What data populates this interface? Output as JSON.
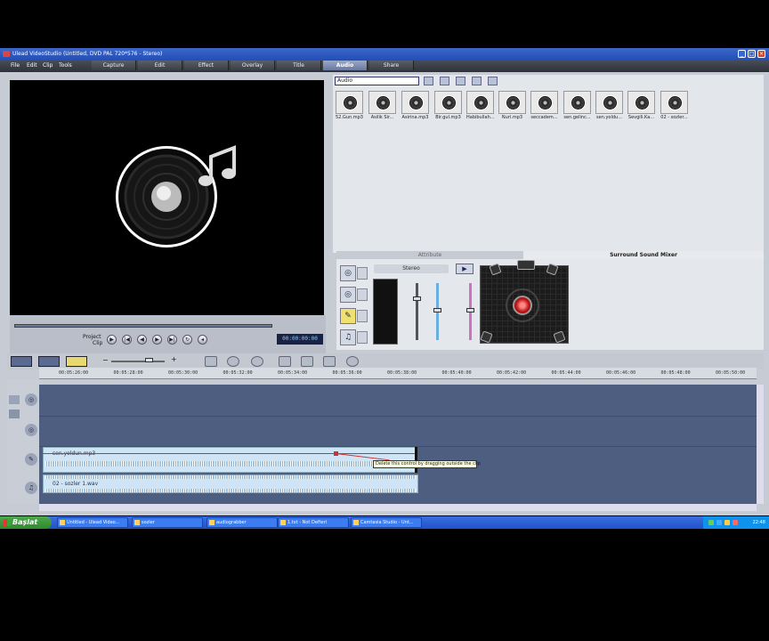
{
  "window": {
    "title": "Ulead VideoStudio (Untitled, DVD PAL 720*576 - Stereo)",
    "menus": [
      "File",
      "Edit",
      "Clip",
      "Tools"
    ],
    "steps": [
      "Capture",
      "Edit",
      "Effect",
      "Overlay",
      "Title",
      "Audio",
      "Share"
    ],
    "active_step": "Audio"
  },
  "preview": {
    "project_label": "Project",
    "clip_label": "Clip",
    "timecode": "00:00:00:00"
  },
  "library": {
    "dropdown_value": "Audio",
    "clips": [
      "52.Gun.mp3",
      "Asilik Sir...",
      "Asirina.mp3",
      "Bir.gul.mp3",
      "Habibullah...",
      "Nuri.mp3",
      "seccadem...",
      "sen.gelinc...",
      "sen.yoldu...",
      "Sevgili.Ka...",
      "02 - sozler..."
    ]
  },
  "options": {
    "tab_attribute": "Attribute",
    "tab_surround": "Surround Sound Mixer",
    "stereo_label": "Stereo"
  },
  "ruler": {
    "ticks": [
      "00:05:26:00",
      "00:05:28:00",
      "00:05:30:00",
      "00:05:32:00",
      "00:05:34:00",
      "00:05:36:00",
      "00:05:38:00",
      "00:05:40:00",
      "00:05:42:00",
      "00:05:44:00",
      "00:05:46:00",
      "00:05:48:00",
      "00:05:50:00"
    ]
  },
  "timeline": {
    "voice_clip": "sen.yoldun.mp3",
    "music_clip": "02 - sozler 1.wav",
    "tooltip": "Delete this control by dragging outside the clip"
  },
  "taskbar": {
    "start_label": "Başlat",
    "tasks": [
      "Untitled - Ulead Video...",
      "sozler",
      "audiograbber",
      "1.txt - Not Defteri",
      "Camtasia Studio - Unt..."
    ],
    "clock": "22:48"
  },
  "colors": {
    "titlebar": "#2350b8",
    "timeline_bg": "#4d5e80",
    "clip_bg": "#cfe4f4",
    "taskbar": "#2152c8"
  }
}
